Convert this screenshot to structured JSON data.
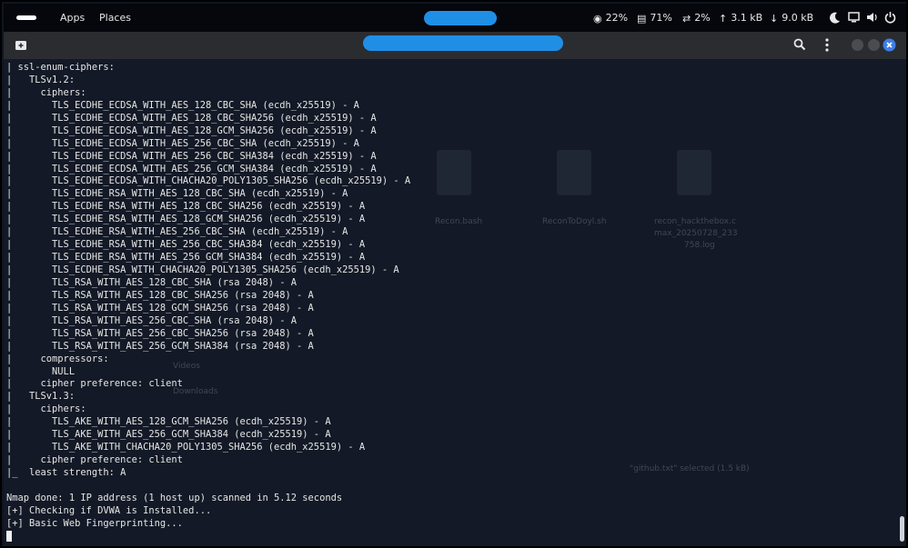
{
  "topbar": {
    "apps_label": "Apps",
    "places_label": "Places",
    "cpu": "22%",
    "memory": "71%",
    "swap": "2%",
    "upload": "3.1 kB",
    "download": "9.0 kB"
  },
  "terminal": {
    "lines": [
      "| ssl-enum-ciphers:",
      "|   TLSv1.2:",
      "|     ciphers:",
      "|       TLS_ECDHE_ECDSA_WITH_AES_128_CBC_SHA (ecdh_x25519) - A",
      "|       TLS_ECDHE_ECDSA_WITH_AES_128_CBC_SHA256 (ecdh_x25519) - A",
      "|       TLS_ECDHE_ECDSA_WITH_AES_128_GCM_SHA256 (ecdh_x25519) - A",
      "|       TLS_ECDHE_ECDSA_WITH_AES_256_CBC_SHA (ecdh_x25519) - A",
      "|       TLS_ECDHE_ECDSA_WITH_AES_256_CBC_SHA384 (ecdh_x25519) - A",
      "|       TLS_ECDHE_ECDSA_WITH_AES_256_GCM_SHA384 (ecdh_x25519) - A",
      "|       TLS_ECDHE_ECDSA_WITH_CHACHA20_POLY1305_SHA256 (ecdh_x25519) - A",
      "|       TLS_ECDHE_RSA_WITH_AES_128_CBC_SHA (ecdh_x25519) - A",
      "|       TLS_ECDHE_RSA_WITH_AES_128_CBC_SHA256 (ecdh_x25519) - A",
      "|       TLS_ECDHE_RSA_WITH_AES_128_GCM_SHA256 (ecdh_x25519) - A",
      "|       TLS_ECDHE_RSA_WITH_AES_256_CBC_SHA (ecdh_x25519) - A",
      "|       TLS_ECDHE_RSA_WITH_AES_256_CBC_SHA384 (ecdh_x25519) - A",
      "|       TLS_ECDHE_RSA_WITH_AES_256_GCM_SHA384 (ecdh_x25519) - A",
      "|       TLS_ECDHE_RSA_WITH_CHACHA20_POLY1305_SHA256 (ecdh_x25519) - A",
      "|       TLS_RSA_WITH_AES_128_CBC_SHA (rsa 2048) - A",
      "|       TLS_RSA_WITH_AES_128_CBC_SHA256 (rsa 2048) - A",
      "|       TLS_RSA_WITH_AES_128_GCM_SHA256 (rsa 2048) - A",
      "|       TLS_RSA_WITH_AES_256_CBC_SHA (rsa 2048) - A",
      "|       TLS_RSA_WITH_AES_256_CBC_SHA256 (rsa 2048) - A",
      "|       TLS_RSA_WITH_AES_256_GCM_SHA384 (rsa 2048) - A",
      "|     compressors:",
      "|       NULL",
      "|     cipher preference: client",
      "|   TLSv1.3:",
      "|     ciphers:",
      "|       TLS_AKE_WITH_AES_128_GCM_SHA256 (ecdh_x25519) - A",
      "|       TLS_AKE_WITH_AES_256_GCM_SHA384 (ecdh_x25519) - A",
      "|       TLS_AKE_WITH_CHACHA20_POLY1305_SHA256 (ecdh_x25519) - A",
      "|     cipher preference: client",
      "|_  least strength: A",
      "",
      "Nmap done: 1 IP address (1 host up) scanned in 5.12 seconds",
      "[+] Checking if DVWA is Installed...",
      "[+] Basic Web Fingerprinting..."
    ]
  },
  "desktop_bg": {
    "files": [
      "Recon.bash",
      "ReconToDoyl.sh",
      "recon_hackthebox.c",
      "max_20250728_233",
      "758.log"
    ],
    "folders": [
      "Videos",
      "Downloads"
    ],
    "status": "\"github.txt\" selected (1.5 kB)"
  },
  "colors": {
    "terminal_bg": "#141a26",
    "terminal_fg": "#e6e6e6",
    "header_bg": "#2a2c30",
    "close_button": "#3d7ee6",
    "redaction": "#1f8fe6"
  },
  "icons": {
    "terminal": "new-tab-icon",
    "search": "search-icon",
    "menu": "kebab-menu-icon",
    "close": "close-icon"
  }
}
